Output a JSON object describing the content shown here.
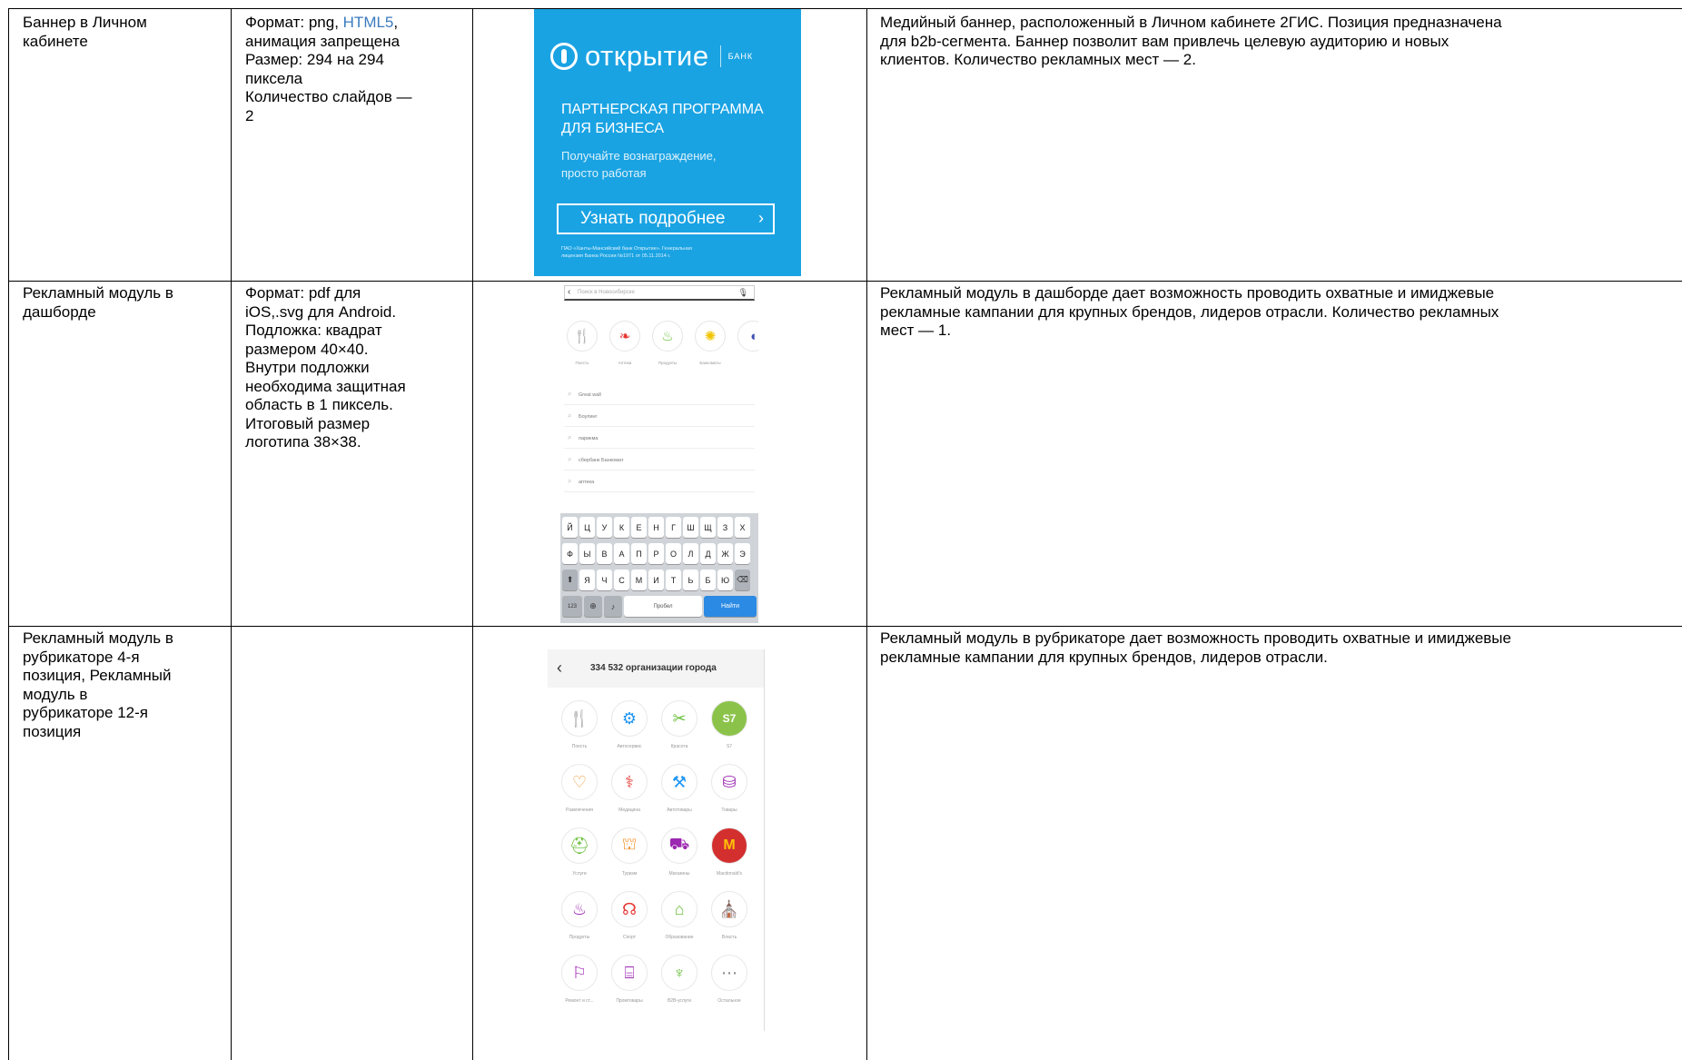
{
  "rows": [
    {
      "name": "Баннер в Личном кабинете",
      "name_lines": [
        "Баннер в Личном",
        "кабинете"
      ],
      "spec_lines": [
        "Формат: png, ",
        "анимация запрещена",
        "Размер: 294 на 294",
        "пиксела",
        "Количество слайдов —",
        "2"
      ],
      "spec_link": "HTML5",
      "spec_link_suffix": ",",
      "desc_lines": [
        "Медийный баннер, расположенный в Личном кабинете 2ГИС. Позиция предназначена",
        "для b2b-сегмента. Баннер позволит вам привлечь целевую аудиторию и новых",
        "клиентов. Количество рекламных мест — 2."
      ]
    },
    {
      "name_lines": [
        "Рекламный модуль в",
        "дашборде"
      ],
      "spec_lines": [
        "Формат: pdf для",
        "iOS,.svg для Android.",
        "Подложка: квадрат",
        "размером 40×40.",
        "Внутри подложки",
        "необходима защитная",
        "область в 1 пиксель.",
        "Итоговый размер",
        "логотипа 38×38."
      ],
      "desc_lines": [
        "Рекламный модуль в дашборде дает возможность проводить охватные и имиджевые",
        "рекламные кампании для крупных брендов, лидеров отрасли. Количество рекламных",
        "мест — 1."
      ]
    },
    {
      "name_lines": [
        "Рекламный модуль в",
        "рубрикаторе 4-я",
        "позиция, Рекламный",
        "модуль в",
        "рубрикаторе 12-я",
        "позиция"
      ],
      "desc_lines": [
        "Рекламный модуль в рубрикаторе дает возможность проводить охватные и имиджевые",
        "рекламные кампании для крупных брендов, лидеров отрасли."
      ]
    }
  ],
  "banner": {
    "brand": "открытие",
    "bank": "БАНК",
    "headline": [
      "ПАРТНЕРСКАЯ ПРОГРАММА",
      "ДЛЯ БИЗНЕСА"
    ],
    "sub": [
      "Получайте вознаграждение,",
      "просто работая"
    ],
    "button": "Узнать подробнее",
    "legal": [
      "ПАО «Ханты-Мансийский банк Открытие». Генеральная",
      "лицензия Банка России №1971 от 05.11.2014 г."
    ],
    "color": "#1aa3e3"
  },
  "dashboard": {
    "search_placeholder": "Поиск в Новосибирске",
    "categories": [
      "Поесть",
      "Аптеки",
      "Продукты",
      "Банкоматы"
    ],
    "suggestions": [
      "Great wall",
      "Боулинг",
      "парикма",
      "сбербанк Банкомат",
      "аптека"
    ],
    "keyboard_rows": [
      [
        "Й",
        "Ц",
        "У",
        "К",
        "Е",
        "Н",
        "Г",
        "Ш",
        "Щ",
        "З",
        "Х"
      ],
      [
        "Ф",
        "Ы",
        "В",
        "А",
        "П",
        "Р",
        "О",
        "Л",
        "Д",
        "Ж",
        "Э"
      ],
      [
        "Я",
        "Ч",
        "С",
        "М",
        "И",
        "Т",
        "Ь",
        "Б",
        "Ю"
      ]
    ],
    "key_123": "123",
    "key_space": "Пробел",
    "key_go": "Найти"
  },
  "rubricator": {
    "title": "334 532 организации города",
    "categories": [
      "Поесть",
      "Автосервис",
      "Красота",
      "S7",
      "Развлечения",
      "Медицина",
      "Автотовары",
      "Товары",
      "Услуги",
      "Туризм",
      "Магазины",
      "Macdonald's",
      "Продукты",
      "Спорт",
      "Образование",
      "Власть",
      "Ремонт и ст...",
      "Промтовары",
      "B2B-услуги",
      "Остальное"
    ]
  }
}
